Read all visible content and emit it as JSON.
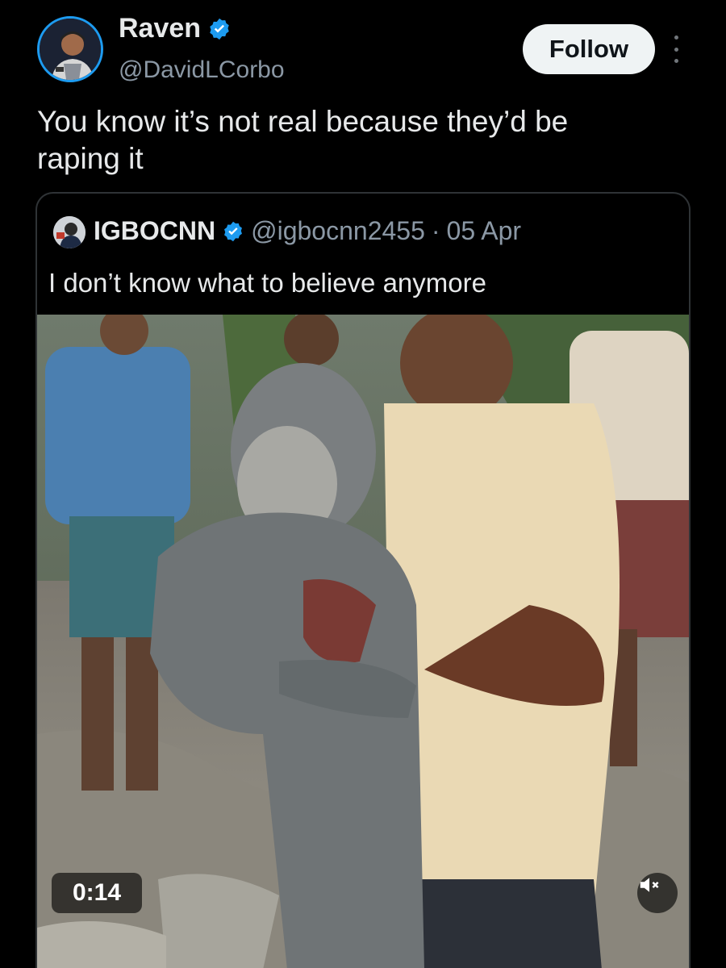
{
  "author": {
    "name": "Raven",
    "handle": "@DavidLCorbo",
    "verified": true,
    "avatar_icon": "user-avatar"
  },
  "actions": {
    "follow_label": "Follow",
    "more_icon": "more-vertical-icon"
  },
  "tweet": {
    "text_line1": "You know it’s not real because they’d be",
    "text_line2": "raping it"
  },
  "quoted": {
    "name": "IGBOCNN",
    "handle": "@igbocnn2455",
    "separator": "·",
    "date": "05 Apr",
    "verified": true,
    "text": "I don’t know what to believe anymore",
    "video": {
      "duration": "0:14",
      "muted": true,
      "mute_icon": "speaker-muted-icon"
    }
  },
  "colors": {
    "background": "#000000",
    "verified": "#1d9bf0",
    "secondary_text": "#8b98a5",
    "follow_bg": "#eff3f4"
  }
}
